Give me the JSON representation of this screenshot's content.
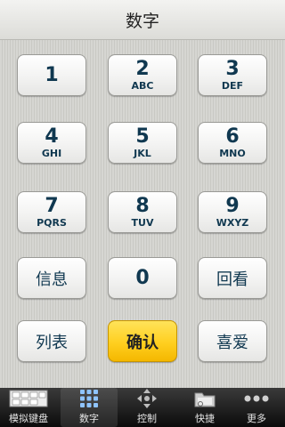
{
  "title": "数字",
  "keys": [
    {
      "num": "1",
      "letters": ""
    },
    {
      "num": "2",
      "letters": "ABC"
    },
    {
      "num": "3",
      "letters": "DEF"
    },
    {
      "num": "4",
      "letters": "GHI"
    },
    {
      "num": "5",
      "letters": "JKL"
    },
    {
      "num": "6",
      "letters": "MNO"
    },
    {
      "num": "7",
      "letters": "PQRS"
    },
    {
      "num": "8",
      "letters": "TUV"
    },
    {
      "num": "9",
      "letters": "WXYZ"
    },
    {
      "num": "0",
      "letters": ""
    }
  ],
  "function_keys": {
    "info": "信息",
    "replay": "回看",
    "list": "列表",
    "confirm": "确认",
    "favorites": "喜爱"
  },
  "tabs": [
    {
      "label": "模拟键盘",
      "icon": "keyboard-icon"
    },
    {
      "label": "数字",
      "icon": "numeric-grid-icon"
    },
    {
      "label": "控制",
      "icon": "dpad-icon"
    },
    {
      "label": "快捷",
      "icon": "folder-icon"
    },
    {
      "label": "更多",
      "icon": "more-dots-icon"
    }
  ],
  "active_tab": "数字",
  "colors": {
    "confirm_key": "#ffcf1f",
    "key_text": "#103850"
  }
}
